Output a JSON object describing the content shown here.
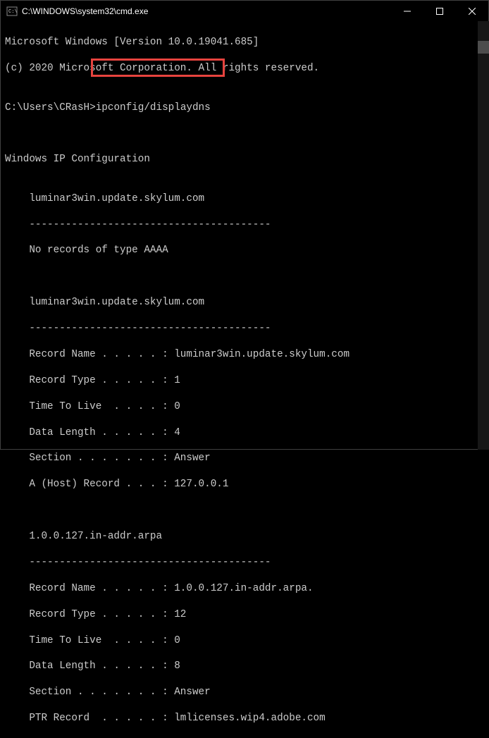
{
  "titlebar": {
    "title": "C:\\WINDOWS\\system32\\cmd.exe"
  },
  "terminal": {
    "line1": "Microsoft Windows [Version 10.0.19041.685]",
    "line2": "(c) 2020 Microsoft Corporation. All rights reserved.",
    "blank1": "",
    "promptLine": {
      "prompt": "C:\\Users\\CRasH>",
      "command": "ipconfig/displaydns"
    },
    "blank2": "",
    "header": "Windows IP Configuration",
    "blank3": "",
    "entry1": {
      "name": "    luminar3win.update.skylum.com",
      "sep": "    ----------------------------------------",
      "msg": "    No records of type AAAA"
    },
    "blank4": "",
    "blank5": "",
    "entry2": {
      "name": "    luminar3win.update.skylum.com",
      "sep": "    ----------------------------------------",
      "r1": "    Record Name . . . . . : luminar3win.update.skylum.com",
      "r2": "    Record Type . . . . . : 1",
      "r3": "    Time To Live  . . . . : 0",
      "r4": "    Data Length . . . . . : 4",
      "r5": "    Section . . . . . . . : Answer",
      "r6": "    A (Host) Record . . . : 127.0.0.1"
    },
    "blank6": "",
    "blank7": "",
    "entry3": {
      "name": "    1.0.0.127.in-addr.arpa",
      "sep": "    ----------------------------------------",
      "r1": "    Record Name . . . . . : 1.0.0.127.in-addr.arpa.",
      "r2": "    Record Type . . . . . : 12",
      "r3": "    Time To Live  . . . . : 0",
      "r4": "    Data Length . . . . . : 8",
      "r5": "    Section . . . . . . . : Answer",
      "r6": "    PTR Record  . . . . . : lmlicenses.wip4.adobe.com"
    }
  }
}
